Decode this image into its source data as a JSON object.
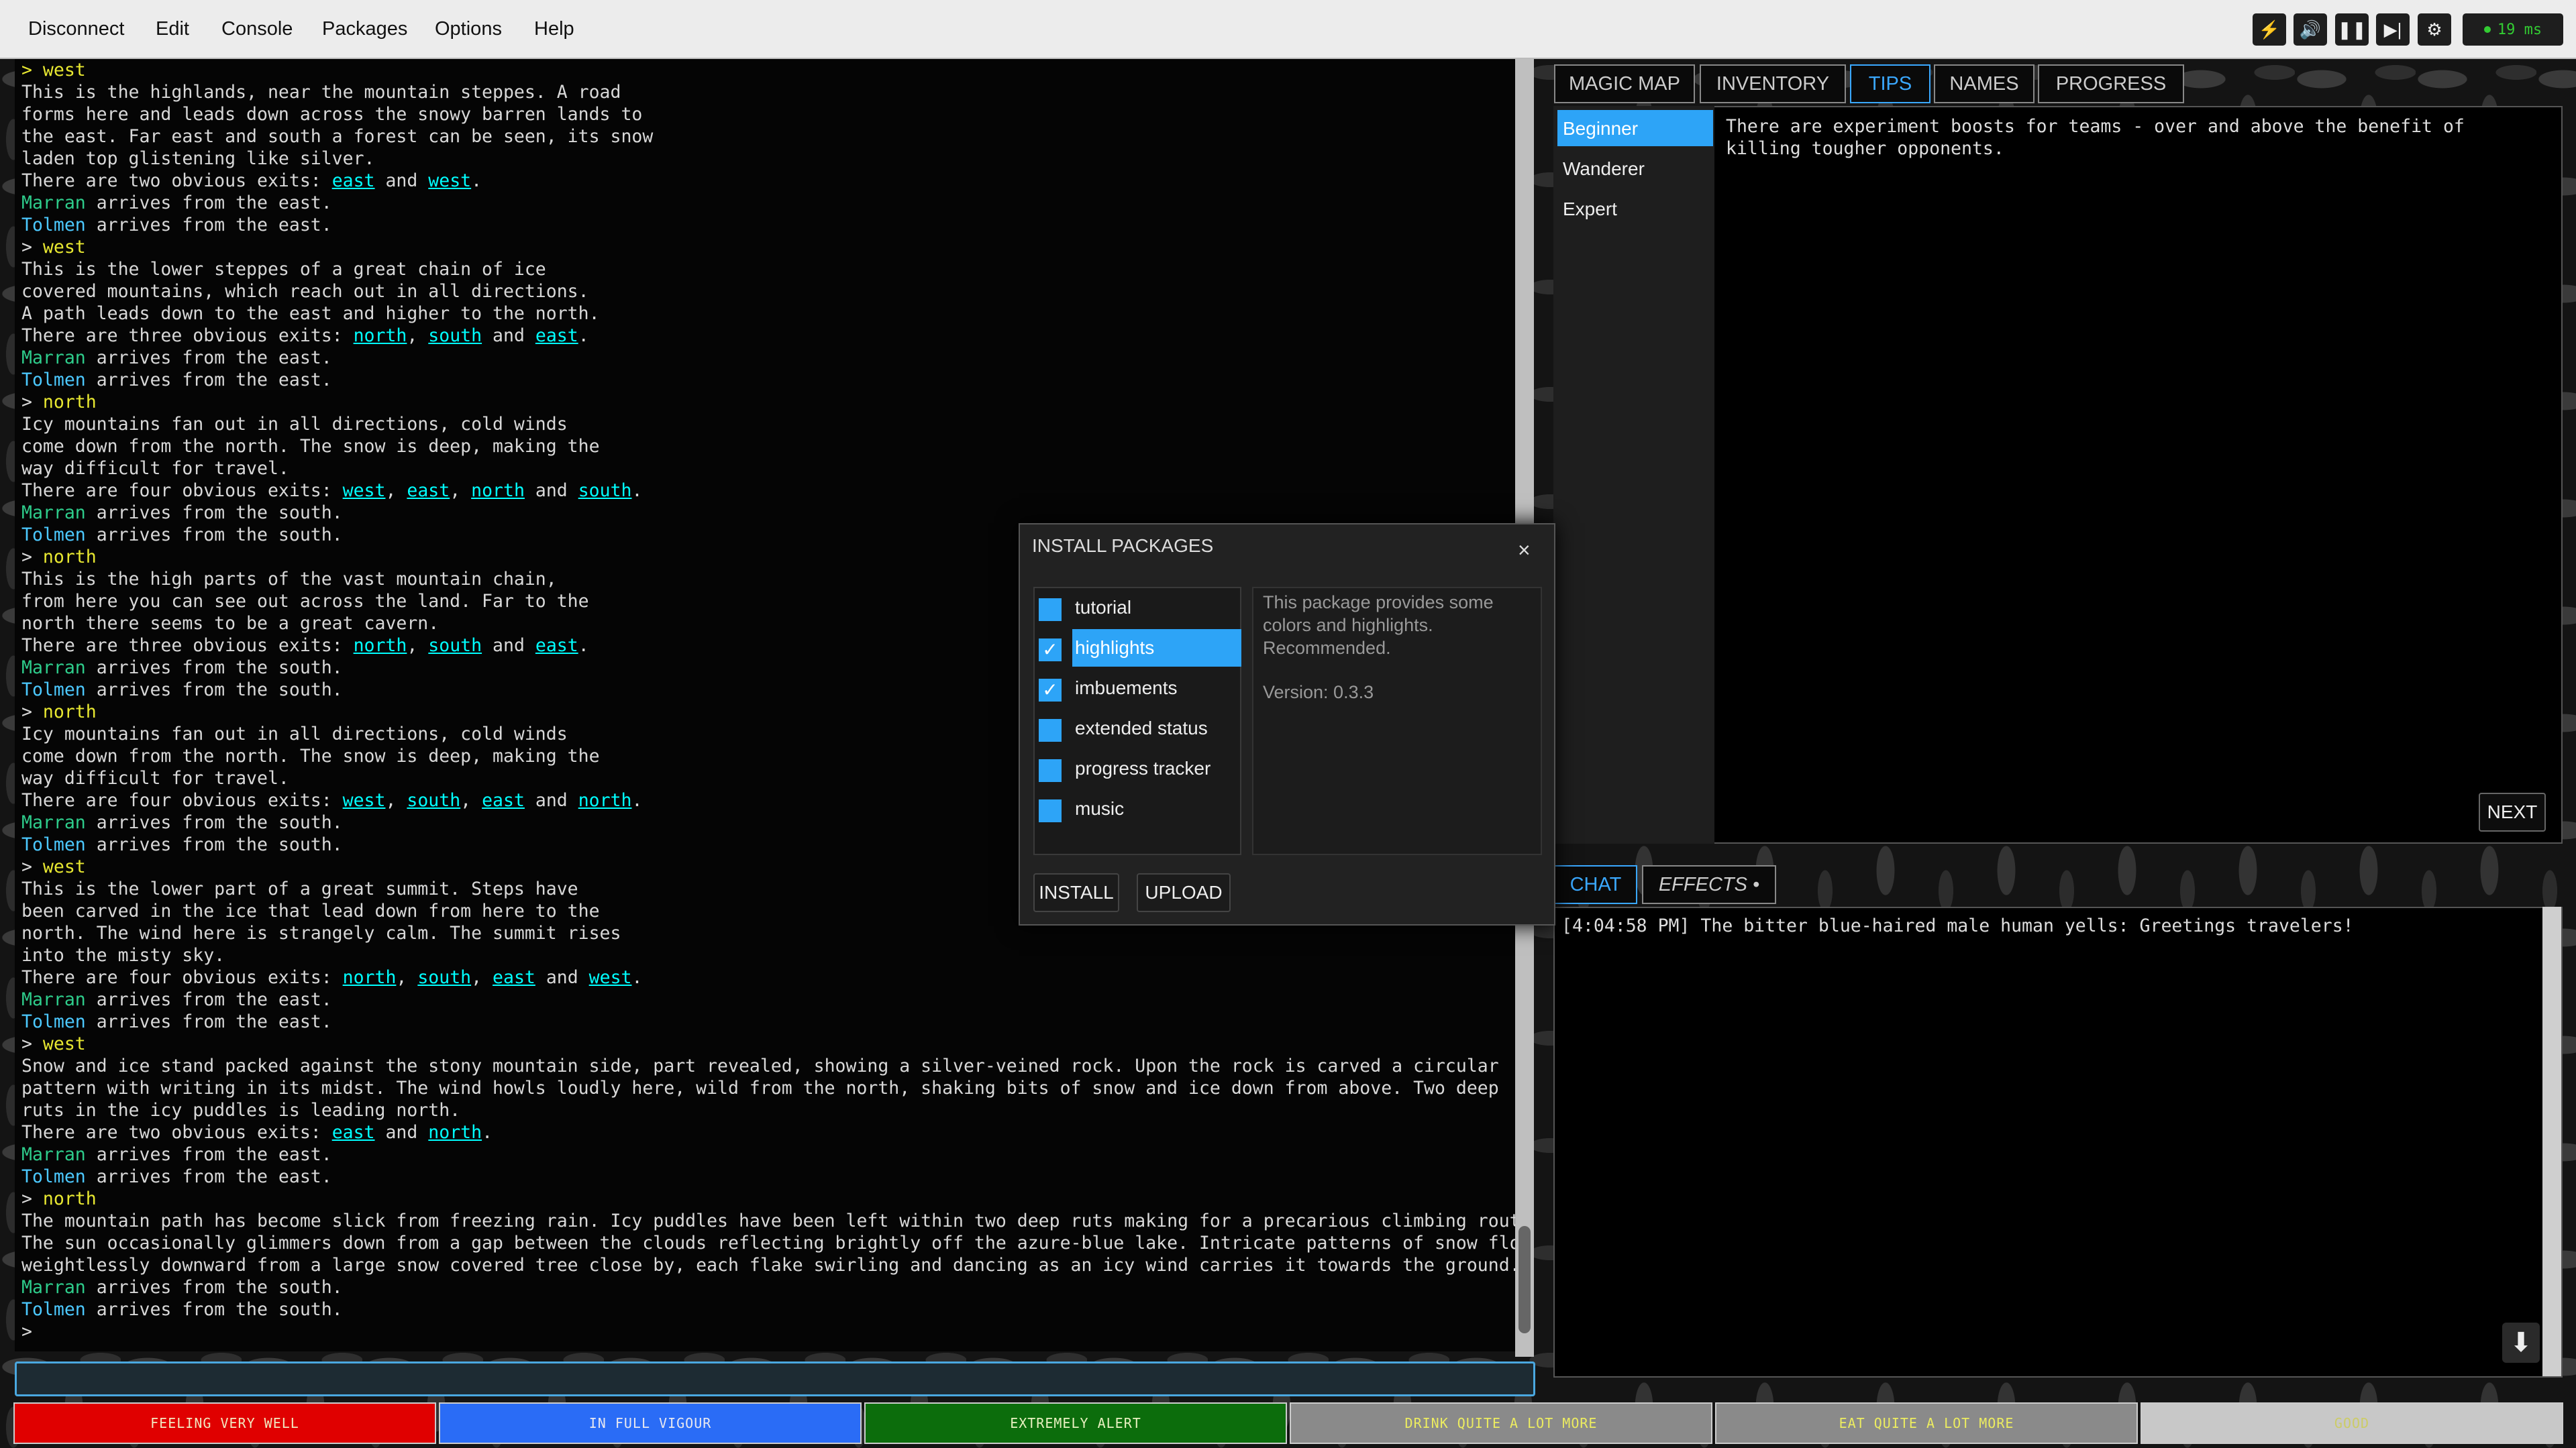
{
  "menu": {
    "items": [
      "Disconnect",
      "Edit",
      "Console",
      "Packages",
      "Options",
      "Help"
    ]
  },
  "toolbar": {
    "ping": "19 ms",
    "icons": [
      "lightning-icon",
      "volume-icon",
      "pause-icon",
      "skip-forward-icon",
      "gear-icon"
    ]
  },
  "main": {
    "lines": [
      [
        {
          "t": "> west",
          "c": "cmd"
        }
      ],
      [
        {
          "t": "This is the highlands, near the mountain steppes. A road"
        }
      ],
      [
        {
          "t": "forms here and leads down across the snowy barren lands to"
        }
      ],
      [
        {
          "t": "the east. Far east and south a forest can be seen, its snow"
        }
      ],
      [
        {
          "t": "laden top glistening like silver."
        }
      ],
      [
        {
          "t": "There are two obvious exits: "
        },
        {
          "t": "east",
          "c": "cy"
        },
        {
          "t": " and "
        },
        {
          "t": "west",
          "c": "cy"
        },
        {
          "t": "."
        }
      ],
      [
        {
          "t": "Marran",
          "c": "gn"
        },
        {
          "t": " arrives from the east."
        }
      ],
      [
        {
          "t": "Tolmen",
          "c": "tl"
        },
        {
          "t": " arrives from the east."
        }
      ],
      [
        {
          "t": "> "
        },
        {
          "t": "west",
          "c": "cmd"
        }
      ],
      [
        {
          "t": "This is the lower steppes of a great chain of ice"
        }
      ],
      [
        {
          "t": "covered mountains, which reach out in all directions."
        }
      ],
      [
        {
          "t": "A path leads down to the east and higher to the north."
        }
      ],
      [
        {
          "t": "There are three obvious exits: "
        },
        {
          "t": "north",
          "c": "cy"
        },
        {
          "t": ", "
        },
        {
          "t": "south",
          "c": "cy"
        },
        {
          "t": " and "
        },
        {
          "t": "east",
          "c": "cy"
        },
        {
          "t": "."
        }
      ],
      [
        {
          "t": "Marran",
          "c": "gn"
        },
        {
          "t": " arrives from the east."
        }
      ],
      [
        {
          "t": "Tolmen",
          "c": "tl"
        },
        {
          "t": " arrives from the east."
        }
      ],
      [
        {
          "t": "> "
        },
        {
          "t": "north",
          "c": "cmd"
        }
      ],
      [
        {
          "t": "Icy mountains fan out in all directions, cold winds"
        }
      ],
      [
        {
          "t": "come down from the north. The snow is deep, making the"
        }
      ],
      [
        {
          "t": "way difficult for travel."
        }
      ],
      [
        {
          "t": "There are four obvious exits: "
        },
        {
          "t": "west",
          "c": "cy"
        },
        {
          "t": ", "
        },
        {
          "t": "east",
          "c": "cy"
        },
        {
          "t": ", "
        },
        {
          "t": "north",
          "c": "cy"
        },
        {
          "t": " and "
        },
        {
          "t": "south",
          "c": "cy"
        },
        {
          "t": "."
        }
      ],
      [
        {
          "t": "Marran",
          "c": "gn"
        },
        {
          "t": " arrives from the south."
        }
      ],
      [
        {
          "t": "Tolmen",
          "c": "tl"
        },
        {
          "t": " arrives from the south."
        }
      ],
      [
        {
          "t": "> "
        },
        {
          "t": "north",
          "c": "cmd"
        }
      ],
      [
        {
          "t": "This is the high parts of the vast mountain chain,"
        }
      ],
      [
        {
          "t": "from here you can see out across the land. Far to the"
        }
      ],
      [
        {
          "t": "north there seems to be a great cavern."
        }
      ],
      [
        {
          "t": "There are three obvious exits: "
        },
        {
          "t": "north",
          "c": "cy"
        },
        {
          "t": ", "
        },
        {
          "t": "south",
          "c": "cy"
        },
        {
          "t": " and "
        },
        {
          "t": "east",
          "c": "cy"
        },
        {
          "t": "."
        }
      ],
      [
        {
          "t": "Marran",
          "c": "gn"
        },
        {
          "t": " arrives from the south."
        }
      ],
      [
        {
          "t": "Tolmen",
          "c": "tl"
        },
        {
          "t": " arrives from the south."
        }
      ],
      [
        {
          "t": "> "
        },
        {
          "t": "north",
          "c": "cmd"
        }
      ],
      [
        {
          "t": "Icy mountains fan out in all directions, cold winds"
        }
      ],
      [
        {
          "t": "come down from the north. The snow is deep, making the"
        }
      ],
      [
        {
          "t": "way difficult for travel."
        }
      ],
      [
        {
          "t": "There are four obvious exits: "
        },
        {
          "t": "west",
          "c": "cy"
        },
        {
          "t": ", "
        },
        {
          "t": "south",
          "c": "cy"
        },
        {
          "t": ", "
        },
        {
          "t": "east",
          "c": "cy"
        },
        {
          "t": " and "
        },
        {
          "t": "north",
          "c": "cy"
        },
        {
          "t": "."
        }
      ],
      [
        {
          "t": "Marran",
          "c": "gn"
        },
        {
          "t": " arrives from the south."
        }
      ],
      [
        {
          "t": "Tolmen",
          "c": "tl"
        },
        {
          "t": " arrives from the south."
        }
      ],
      [
        {
          "t": "> "
        },
        {
          "t": "west",
          "c": "cmd"
        }
      ],
      [
        {
          "t": "This is the lower part of a great summit. Steps have"
        }
      ],
      [
        {
          "t": "been carved in the ice that lead down from here to the"
        }
      ],
      [
        {
          "t": "north. The wind here is strangely calm. The summit rises"
        }
      ],
      [
        {
          "t": "into the misty sky."
        }
      ],
      [
        {
          "t": "There are four obvious exits: "
        },
        {
          "t": "north",
          "c": "cy"
        },
        {
          "t": ", "
        },
        {
          "t": "south",
          "c": "cy"
        },
        {
          "t": ", "
        },
        {
          "t": "east",
          "c": "cy"
        },
        {
          "t": " and "
        },
        {
          "t": "west",
          "c": "cy"
        },
        {
          "t": "."
        }
      ],
      [
        {
          "t": "Marran",
          "c": "gn"
        },
        {
          "t": " arrives from the east."
        }
      ],
      [
        {
          "t": "Tolmen",
          "c": "tl"
        },
        {
          "t": " arrives from the east."
        }
      ],
      [
        {
          "t": "> "
        },
        {
          "t": "west",
          "c": "cmd"
        }
      ],
      [
        {
          "t": "Snow and ice stand packed against the stony mountain side, part revealed, showing a silver-veined rock. Upon the rock is carved a circular"
        }
      ],
      [
        {
          "t": "pattern with writing in its midst. The wind howls loudly here, wild from the north, shaking bits of snow and ice down from above. Two deep"
        }
      ],
      [
        {
          "t": "ruts in the icy puddles is leading north."
        }
      ],
      [
        {
          "t": "There are two obvious exits: "
        },
        {
          "t": "east",
          "c": "cy"
        },
        {
          "t": " and "
        },
        {
          "t": "north",
          "c": "cy"
        },
        {
          "t": "."
        }
      ],
      [
        {
          "t": "Marran",
          "c": "gn"
        },
        {
          "t": " arrives from the east."
        }
      ],
      [
        {
          "t": "Tolmen",
          "c": "tl"
        },
        {
          "t": " arrives from the east."
        }
      ],
      [
        {
          "t": "> "
        },
        {
          "t": "north",
          "c": "cmd"
        }
      ],
      [
        {
          "t": "The mountain path has become slick from freezing rain. Icy puddles have been left within two deep ruts making for a precarious climbing route."
        }
      ],
      [
        {
          "t": "The sun occasionally glimmers down from a gap between the clouds reflecting brightly off the azure-blue lake. Intricate patterns of snow float"
        }
      ],
      [
        {
          "t": "weightlessly downward from a large snow covered tree close by, each flake swirling and dancing as an icy wind carries it towards the ground."
        }
      ],
      [
        {
          "t": "Marran",
          "c": "gn"
        },
        {
          "t": " arrives from the south."
        }
      ],
      [
        {
          "t": "Tolmen",
          "c": "tl"
        },
        {
          "t": " arrives from the south."
        }
      ],
      [
        {
          "t": ">"
        }
      ]
    ]
  },
  "right_tabs": [
    "MAGIC MAP",
    "INVENTORY",
    "TIPS",
    "NAMES",
    "PROGRESS"
  ],
  "tips": {
    "levels": [
      "Beginner",
      "Wanderer",
      "Expert"
    ],
    "text": "There are experiment boosts for teams - over and above the benefit of killing tougher opponents.",
    "next_label": "NEXT"
  },
  "bottom_tabs": [
    "CHAT",
    "EFFECTS •"
  ],
  "chat": {
    "line": "[4:04:58 PM] The bitter blue-haired male human yells: Greetings travelers!"
  },
  "status": [
    {
      "label": "FEELING VERY WELL",
      "bg": "#e00000",
      "fg": "#f2e8c0"
    },
    {
      "label": "IN FULL VIGOUR",
      "bg": "#2a6cf6",
      "fg": "#e8e8f0"
    },
    {
      "label": "EXTREMELY ALERT",
      "bg": "#0c6d0c",
      "fg": "#e8f0c0"
    },
    {
      "label": "DRINK QUITE A LOT MORE",
      "bg": "#8a8a8a",
      "fg": "#ecec60"
    },
    {
      "label": "EAT QUITE A LOT MORE",
      "bg": "#8a8a8a",
      "fg": "#ecec60"
    },
    {
      "label": "GOOD",
      "bg": "#c8c8c8",
      "fg": "#cccc66"
    }
  ],
  "dialog": {
    "title": "INSTALL PACKAGES",
    "close": "×",
    "packages": [
      {
        "name": "tutorial",
        "checked": false,
        "selected": false
      },
      {
        "name": "highlights",
        "checked": true,
        "selected": true
      },
      {
        "name": "imbuements",
        "checked": true,
        "selected": false
      },
      {
        "name": "extended status",
        "checked": false,
        "selected": false
      },
      {
        "name": "progress tracker",
        "checked": false,
        "selected": false
      },
      {
        "name": "music",
        "checked": false,
        "selected": false
      }
    ],
    "description": "This package provides some colors and highlights. Recommended.",
    "version": "Version: 0.3.3",
    "install_label": "INSTALL",
    "upload_label": "UPLOAD"
  }
}
